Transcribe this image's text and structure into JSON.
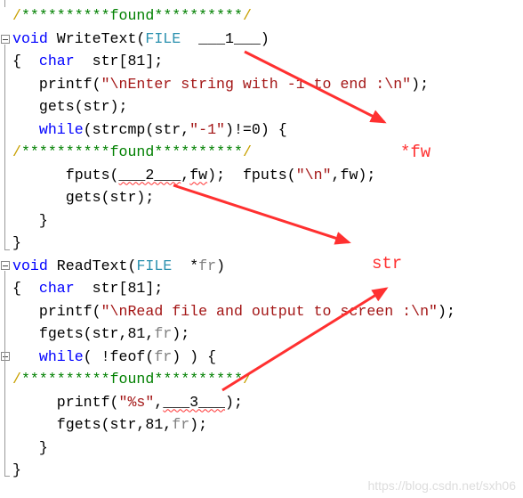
{
  "code_lines": [
    [
      [
        "/",
        "cs"
      ],
      [
        "**********",
        "cm"
      ],
      [
        "found",
        "cm"
      ],
      [
        "**********",
        "cm"
      ],
      [
        "/",
        "cs"
      ]
    ],
    [
      [
        "void",
        "kw"
      ],
      [
        " WriteText(",
        ""
      ],
      [
        "FILE",
        "ty"
      ],
      [
        "  ___1___)",
        ""
      ]
    ],
    [
      [
        "{  ",
        ""
      ],
      [
        "char",
        "kw"
      ],
      [
        "  str[81];",
        ""
      ]
    ],
    [
      [
        "   printf(",
        ""
      ],
      [
        "\"\\nEnter string with -1 to end :\\n\"",
        "str"
      ],
      [
        ");",
        ""
      ]
    ],
    [
      [
        "   gets(str);",
        ""
      ]
    ],
    [
      [
        "   ",
        ""
      ],
      [
        "while",
        "kw"
      ],
      [
        "(strcmp(str,",
        ""
      ],
      [
        "\"-1\"",
        "str"
      ],
      [
        ")!=0) {",
        ""
      ]
    ],
    [
      [
        "/",
        "cs"
      ],
      [
        "**********",
        "cm"
      ],
      [
        "found",
        "cm"
      ],
      [
        "**********",
        "cm"
      ],
      [
        "/",
        "cs"
      ]
    ],
    [
      [
        "      fputs(",
        ""
      ],
      [
        "___2___",
        "err"
      ],
      [
        ",",
        ""
      ],
      [
        "fw",
        "err"
      ],
      [
        ");  fputs(",
        ""
      ],
      [
        "\"\\n\"",
        "str"
      ],
      [
        ",fw);",
        ""
      ]
    ],
    [
      [
        "      gets(str);",
        ""
      ]
    ],
    [
      [
        "   }",
        ""
      ]
    ],
    [
      [
        "}",
        ""
      ]
    ],
    [
      [
        "void",
        "kw"
      ],
      [
        " ReadText(",
        ""
      ],
      [
        "FILE",
        "ty"
      ],
      [
        "  *",
        ""
      ],
      [
        "fr",
        "par"
      ],
      [
        ")",
        ""
      ]
    ],
    [
      [
        "{  ",
        ""
      ],
      [
        "char",
        "kw"
      ],
      [
        "  str[81];",
        ""
      ]
    ],
    [
      [
        "   printf(",
        ""
      ],
      [
        "\"\\nRead file and output to screen :\\n\"",
        "str"
      ],
      [
        ");",
        ""
      ]
    ],
    [
      [
        "   fgets(str,81,",
        ""
      ],
      [
        "fr",
        "par"
      ],
      [
        ");",
        ""
      ]
    ],
    [
      [
        "   ",
        ""
      ],
      [
        "while",
        "kw"
      ],
      [
        "( !feof(",
        ""
      ],
      [
        "fr",
        "par"
      ],
      [
        ") ) {",
        ""
      ]
    ],
    [
      [
        "/",
        "cs"
      ],
      [
        "**********",
        "cm"
      ],
      [
        "found",
        "cm"
      ],
      [
        "**********",
        "cm"
      ],
      [
        "/",
        "cs"
      ]
    ],
    [
      [
        "     printf(",
        ""
      ],
      [
        "\"%s\"",
        "str"
      ],
      [
        ",",
        ""
      ],
      [
        "___3___",
        "err"
      ],
      [
        ");",
        ""
      ]
    ],
    [
      [
        "     fgets(str,81,",
        ""
      ],
      [
        "fr",
        "par"
      ],
      [
        ");",
        ""
      ]
    ],
    [
      [
        "   }",
        ""
      ]
    ],
    [
      [
        "}",
        ""
      ]
    ]
  ],
  "annotations": {
    "answer_1": "*fw",
    "answer_2": "str"
  },
  "watermark": "https://blog.csdn.net/sxh06",
  "colors": {
    "keyword": "#0000ff",
    "type": "#2b91af",
    "string": "#a31515",
    "comment": "#008000",
    "arrow": "#ff3030"
  }
}
